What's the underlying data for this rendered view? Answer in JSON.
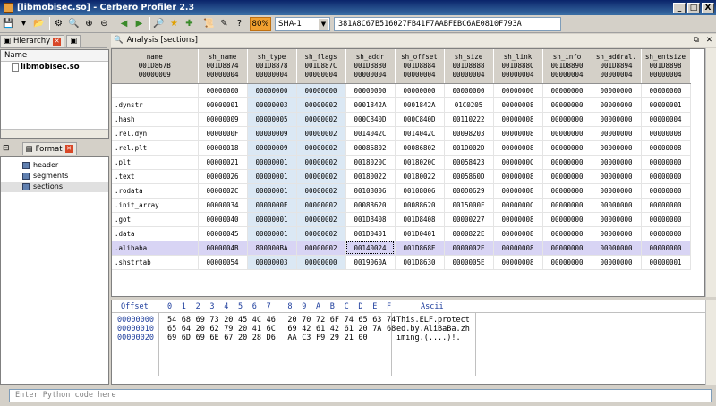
{
  "window": {
    "title": "[libmobisec.so] - Cerbero Profiler 2.3",
    "buttons": [
      "_",
      "□",
      "X"
    ]
  },
  "toolbar": {
    "icons": [
      "save-icon",
      "dropdown-icon",
      "open-icon",
      "print-icon",
      "search-icon",
      "search-next-icon",
      "search-prev-icon",
      "back-icon",
      "forward-icon",
      "find-icon",
      "star-icon",
      "bookmark-icon",
      "script-icon",
      "edit-icon",
      "help-icon"
    ],
    "percent": "80%",
    "hash_algo": "SHA-1",
    "hash_value": "381A8C67B516027FB41F7AABFEBC6AE0810F793A"
  },
  "left": {
    "hierarchy_tab": "Hierarchy",
    "tree_header": "Name",
    "tree_items": [
      "libmobisec.so"
    ],
    "format_tab": "Format",
    "format_items": [
      {
        "label": "header"
      },
      {
        "label": "segments"
      },
      {
        "label": "sections"
      }
    ]
  },
  "analysis": {
    "title": "Analysis [sections]"
  },
  "table": {
    "columns": [
      {
        "name": "name",
        "offset": "001D867B",
        "size": "00000009"
      },
      {
        "name": "sh_name",
        "offset": "001D8874",
        "size": "00000004"
      },
      {
        "name": "sh_type",
        "offset": "001D8878",
        "size": "00000004"
      },
      {
        "name": "sh_flags",
        "offset": "001D887C",
        "size": "00000004"
      },
      {
        "name": "sh_addr",
        "offset": "001D8880",
        "size": "00000004"
      },
      {
        "name": "sh_offset",
        "offset": "001D8884",
        "size": "00000004"
      },
      {
        "name": "sh_size",
        "offset": "001D8888",
        "size": "00000004"
      },
      {
        "name": "sh_link",
        "offset": "001D888C",
        "size": "00000004"
      },
      {
        "name": "sh_info",
        "offset": "001D8890",
        "size": "00000004"
      },
      {
        "name": "sh_addral.",
        "offset": "001D8894",
        "size": "00000004"
      },
      {
        "name": "sh_entsize",
        "offset": "001D8898",
        "size": "00000004"
      }
    ],
    "rows": [
      [
        "",
        "00000000",
        "00000000",
        "00000000",
        "00000000",
        "00000000",
        "00000000",
        "00000000",
        "00000000",
        "00000000",
        "00000000"
      ],
      [
        ".dynstr",
        "00000001",
        "00000003",
        "00000002",
        "0001842A",
        "0001842A",
        "01C0205",
        "00000008",
        "00000000",
        "00000000",
        "00000001"
      ],
      [
        ".hash",
        "00000009",
        "00000005",
        "00000002",
        "000C840D",
        "000C840D",
        "00110222",
        "00000008",
        "00000000",
        "00000000",
        "00000004"
      ],
      [
        ".rel.dyn",
        "0000000F",
        "00000009",
        "00000002",
        "0014042C",
        "0014042C",
        "00098203",
        "00000008",
        "00000000",
        "00000000",
        "00000008"
      ],
      [
        ".rel.plt",
        "00000018",
        "00000009",
        "00000002",
        "00086802",
        "00086802",
        "001D002D",
        "00000008",
        "00000000",
        "00000000",
        "00000008"
      ],
      [
        ".plt",
        "00000021",
        "00000001",
        "00000002",
        "0018020C",
        "0018020C",
        "00058423",
        "0000000C",
        "00000000",
        "00000000",
        "00000000"
      ],
      [
        ".text",
        "00000026",
        "00000001",
        "00000002",
        "00180022",
        "00180022",
        "0005860D",
        "00000008",
        "00000000",
        "00000000",
        "00000000"
      ],
      [
        ".rodata",
        "0000002C",
        "00000001",
        "00000002",
        "00108006",
        "00108006",
        "000D0629",
        "00000008",
        "00000000",
        "00000000",
        "00000000"
      ],
      [
        ".init_array",
        "00000034",
        "0000000E",
        "00000002",
        "00088620",
        "00088620",
        "0015000F",
        "0000000C",
        "00000000",
        "00000000",
        "00000000"
      ],
      [
        ".got",
        "00000040",
        "00000001",
        "00000002",
        "001D8408",
        "001D8408",
        "00000227",
        "00000008",
        "00000000",
        "00000000",
        "00000000"
      ],
      [
        ".data",
        "00000045",
        "00000001",
        "00000002",
        "001D0401",
        "001D0401",
        "0000822E",
        "00000008",
        "00000000",
        "00000000",
        "00000000"
      ],
      [
        ".alibaba",
        "0000004B",
        "800000BA",
        "00000002",
        "00140024",
        "001D868E",
        "0000002E",
        "00000008",
        "00000000",
        "00000000",
        "00000000"
      ],
      [
        ".shstrtab",
        "00000054",
        "00000003",
        "00000000",
        "0019060A",
        "001D8630",
        "0000005E",
        "00000008",
        "00000000",
        "00000000",
        "00000001"
      ]
    ],
    "selected_row": 11
  },
  "hex": {
    "header_offset": "Offset",
    "header_digits": [
      "0",
      "1",
      "2",
      "3",
      "4",
      "5",
      "6",
      "7",
      "8",
      "9",
      "A",
      "B",
      "C",
      "D",
      "E",
      "F"
    ],
    "header_ascii": "Ascii",
    "rows": [
      {
        "offset": "00000000",
        "bytes": [
          "54",
          "68",
          "69",
          "73",
          "20",
          "45",
          "4C",
          "46",
          "20",
          "70",
          "72",
          "6F",
          "74",
          "65",
          "63",
          "74"
        ],
        "ascii": "This.ELF.protect"
      },
      {
        "offset": "00000010",
        "bytes": [
          "65",
          "64",
          "20",
          "62",
          "79",
          "20",
          "41",
          "6C",
          "69",
          "42",
          "61",
          "42",
          "61",
          "20",
          "7A",
          "68"
        ],
        "ascii": "ed.by.AliBaBa.zh"
      },
      {
        "offset": "00000020",
        "bytes": [
          "69",
          "6D",
          "69",
          "6E",
          "67",
          "20",
          "28",
          "D6",
          "AA",
          "C3",
          "F9",
          "29",
          "21",
          "00"
        ],
        "ascii": "iming.(....)!."
      }
    ]
  },
  "python": {
    "placeholder": "Enter Python code here"
  }
}
